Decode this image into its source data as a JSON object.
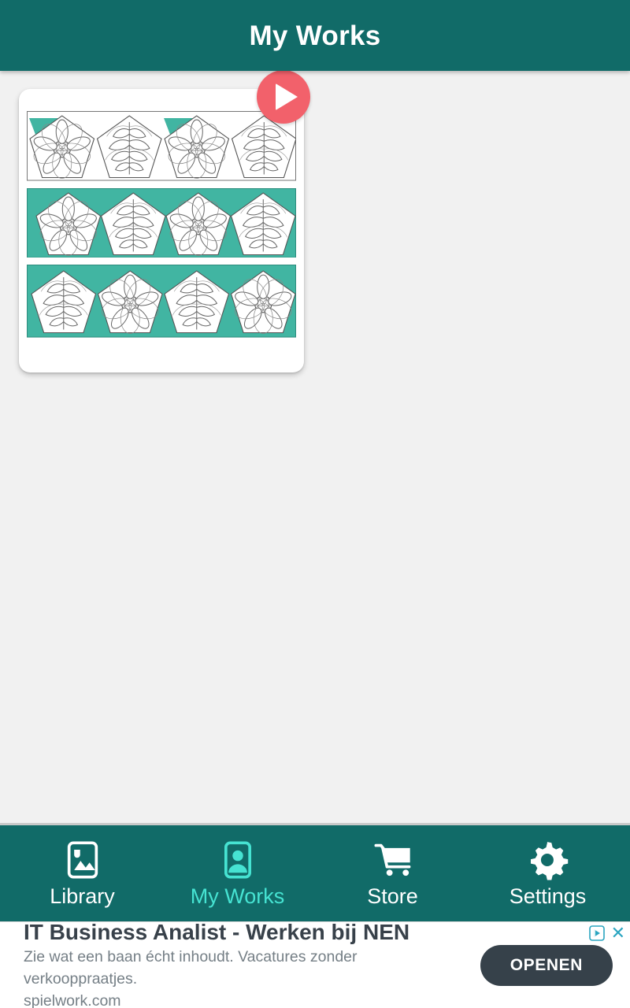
{
  "theme": {
    "header_bg": "#116b68",
    "nav_bg": "#116b68",
    "active_accent": "#46e3d2",
    "page_bg": "#f1f1f1",
    "card_bg": "#ffffff",
    "play_button_bg": "#f2616b",
    "artwork_teal": "#41b5a2",
    "ad_cta_bg": "#36414a"
  },
  "header": {
    "title": "My Works"
  },
  "main": {
    "works": [
      {
        "name": "pentagon-floral-pattern",
        "play_label": "play-icon",
        "rows": [
          {
            "background": "none",
            "tiles": [
              "flower",
              "leaf",
              "flower",
              "leaf"
            ]
          },
          {
            "background": "teal",
            "tiles": [
              "flower",
              "leaf",
              "flower",
              "leaf"
            ]
          },
          {
            "background": "teal",
            "tiles": [
              "leaf",
              "flower",
              "leaf",
              "flower"
            ]
          }
        ]
      }
    ]
  },
  "bottom_nav": {
    "items": [
      {
        "label": "Library",
        "icon": "image-icon",
        "active": false
      },
      {
        "label": "My Works",
        "icon": "person-icon",
        "active": true
      },
      {
        "label": "Store",
        "icon": "cart-icon",
        "active": false
      },
      {
        "label": "Settings",
        "icon": "gear-icon",
        "active": false
      }
    ]
  },
  "ad": {
    "headline": "IT Business Analist - Werken bij NEN",
    "body": "Zie wat een baan écht inhoudt. Vacatures zonder verkooppraatjes.",
    "url": "spielwork.com",
    "cta_label": "OPENEN",
    "close_label": "✕",
    "adchoices_label": "adchoices-icon"
  }
}
